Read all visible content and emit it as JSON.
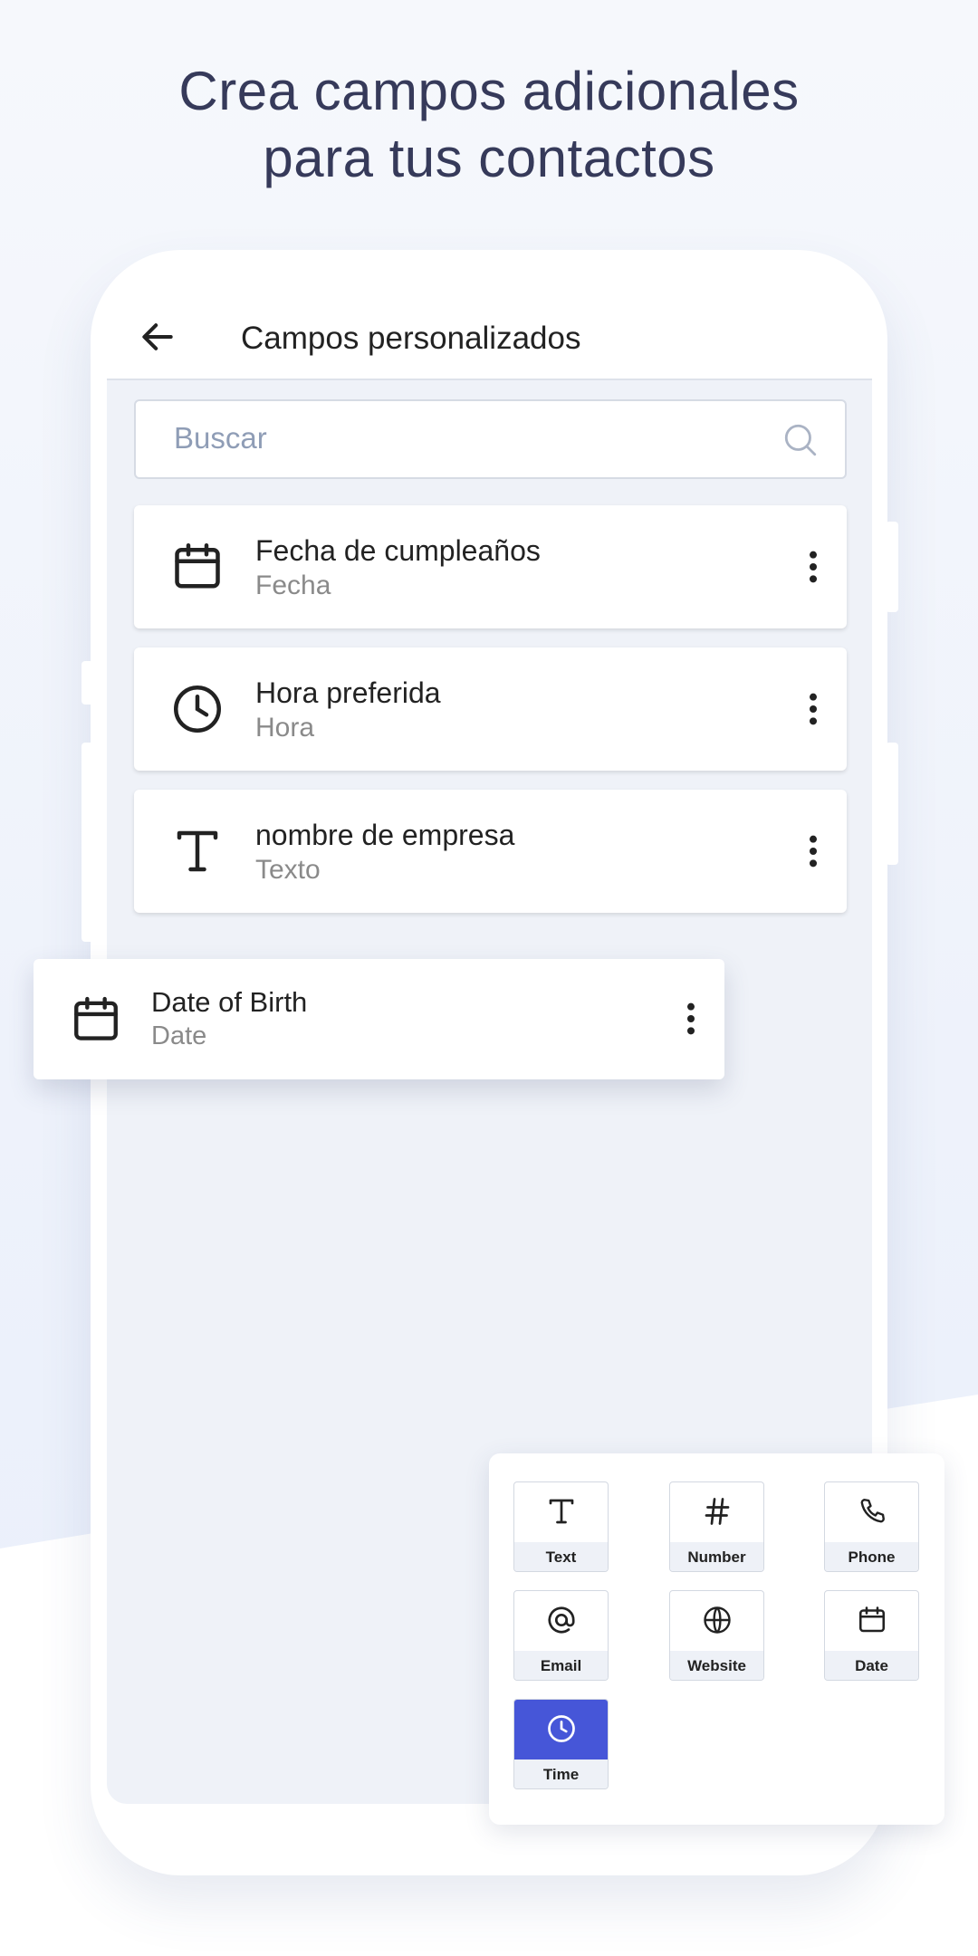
{
  "headline": {
    "line1": "Crea campos adicionales",
    "line2": "para tus contactos"
  },
  "appbar": {
    "title": "Campos personalizados",
    "back_icon": "arrow-left-icon"
  },
  "search": {
    "placeholder": "Buscar"
  },
  "fields": [
    {
      "name": "Fecha de cumpleaños",
      "type": "Fecha",
      "icon": "calendar-icon"
    },
    {
      "name": "Hora preferida",
      "type": "Hora",
      "icon": "clock-icon"
    },
    {
      "name": "nombre de empresa",
      "type": "Texto",
      "icon": "text-icon"
    }
  ],
  "dragged_field": {
    "name": "Date of Birth",
    "type": "Date",
    "icon": "calendar-icon"
  },
  "picker": {
    "items": [
      {
        "label": "Text",
        "icon": "text-icon"
      },
      {
        "label": "Number",
        "icon": "hash-icon"
      },
      {
        "label": "Phone",
        "icon": "phone-icon"
      },
      {
        "label": "Email",
        "icon": "at-icon"
      },
      {
        "label": "Website",
        "icon": "globe-icon"
      },
      {
        "label": "Date",
        "icon": "calendar-icon"
      },
      {
        "label": "Time",
        "icon": "clock-icon",
        "selected": true
      }
    ]
  },
  "colors": {
    "accent": "#4656d8",
    "headline": "#363a5a",
    "screen_bg": "#eff2f8"
  }
}
